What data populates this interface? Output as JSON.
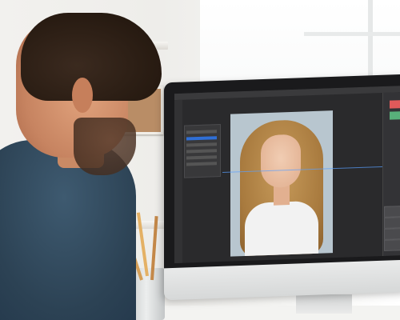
{
  "scene": {
    "subject": "",
    "app_panels": {
      "layers_count": 6
    }
  },
  "colors": {
    "screen_dark": "#2a2a2c",
    "selection_blue": "#2f6fd6",
    "guide_blue": "#5aa0ff",
    "shirt": "#2c4254"
  }
}
